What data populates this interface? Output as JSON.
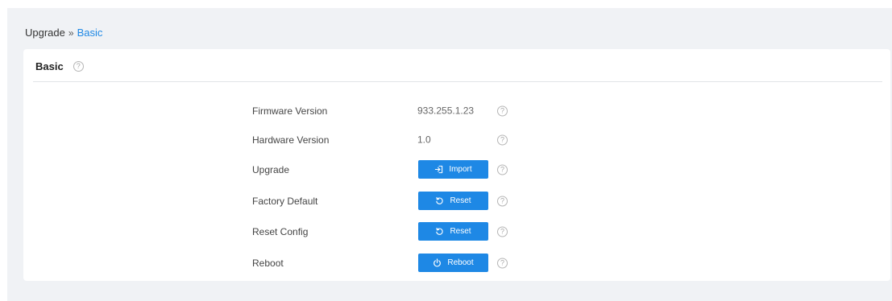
{
  "breadcrumb": {
    "parent": "Upgrade",
    "separator": "»",
    "current": "Basic"
  },
  "card": {
    "title": "Basic",
    "help_glyph": "?"
  },
  "rows": [
    {
      "label": "Firmware Version",
      "value": "933.255.1.23"
    },
    {
      "label": "Hardware Version",
      "value": "1.0"
    },
    {
      "label": "Upgrade",
      "button": {
        "label": "Import",
        "icon": "import-icon"
      }
    },
    {
      "label": "Factory Default",
      "button": {
        "label": "Reset",
        "icon": "reset-icon"
      }
    },
    {
      "label": "Reset Config",
      "button": {
        "label": "Reset",
        "icon": "reset-icon"
      }
    },
    {
      "label": "Reboot",
      "button": {
        "label": "Reboot",
        "icon": "power-icon"
      }
    }
  ],
  "colors": {
    "primary": "#1e88e5",
    "background": "#f0f2f5",
    "card": "#ffffff"
  }
}
